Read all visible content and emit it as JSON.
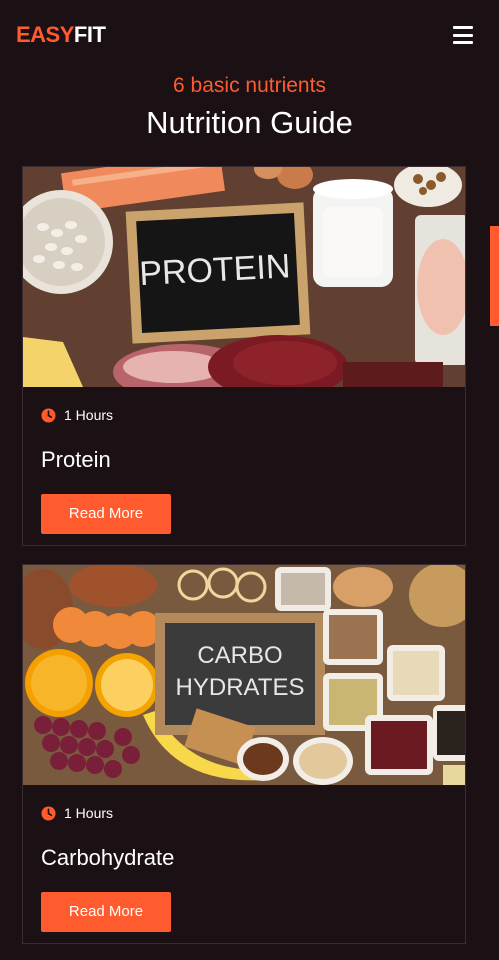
{
  "header": {
    "logo_part1": "EASY",
    "logo_part2": "FIT",
    "menu_icon": "hamburger-menu-icon"
  },
  "intro": {
    "subtitle": "6 basic nutrients",
    "title": "Nutrition Guide"
  },
  "cards": [
    {
      "image_alt": "Protein foods with chalkboard sign",
      "image_board_text": "PROTEIN",
      "duration": "1 Hours",
      "title": "Protein",
      "button_label": "Read More"
    },
    {
      "image_alt": "Carbohydrate foods with chalkboard sign",
      "image_board_line1": "CARBO",
      "image_board_line2": "HYDRATES",
      "duration": "1 Hours",
      "title": "Carbohydrate",
      "button_label": "Read More"
    }
  ],
  "colors": {
    "accent": "#ff5b2e",
    "background": "#1b1014",
    "card_border": "#3a2c31"
  }
}
